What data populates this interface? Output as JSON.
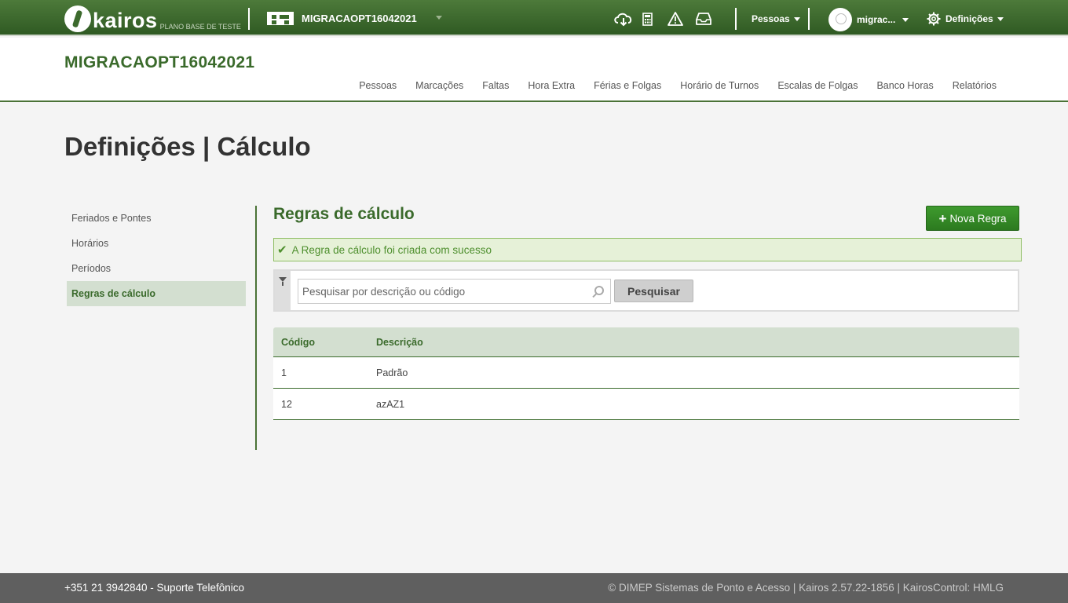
{
  "topbar": {
    "logo_text": "kairos",
    "logo_subtitle": "PLANO BASE DE TESTE",
    "company_name": "MIGRACAOPT16042021",
    "icons": [
      "cloud-download-icon",
      "calculator-icon",
      "warning-icon",
      "inbox-icon"
    ],
    "people_menu": "Pessoas",
    "user_name": "migrac...",
    "settings_menu": "Definições"
  },
  "header": {
    "company_title": "MIGRACAOPT16042021",
    "nav": [
      "Pessoas",
      "Marcações",
      "Faltas",
      "Hora Extra",
      "Férias e Folgas",
      "Horário de Turnos",
      "Escalas de Folgas",
      "Banco Horas",
      "Relatórios"
    ]
  },
  "page": {
    "title": "Definições | Cálculo"
  },
  "sidenav": {
    "items": [
      "Feriados e Pontes",
      "Horários",
      "Períodos",
      "Regras de cálculo"
    ],
    "active_index": 3
  },
  "content": {
    "section_title": "Regras de cálculo",
    "new_button": "Nova Regra",
    "alert_message": "A Regra de cálculo foi criada com sucesso",
    "search_placeholder": "Pesquisar por descrição ou código",
    "search_button": "Pesquisar",
    "table": {
      "headers": [
        "Código",
        "Descrição"
      ],
      "rows": [
        {
          "code": "1",
          "description": "Padrão"
        },
        {
          "code": "12",
          "description": "azAZ1"
        }
      ]
    }
  },
  "footer": {
    "left": "+351 21 3942840 - Suporte Telefônico",
    "right": "© DIMEP Sistemas de Ponto e Acesso | Kairos 2.57.22-1856 | KairosControl: HMLG"
  },
  "colors": {
    "brand_green": "#3a6a2b",
    "topbar_green": "#2f5a23",
    "success_bg": "#e6f1d8",
    "button_green": "#2c7a1f"
  }
}
